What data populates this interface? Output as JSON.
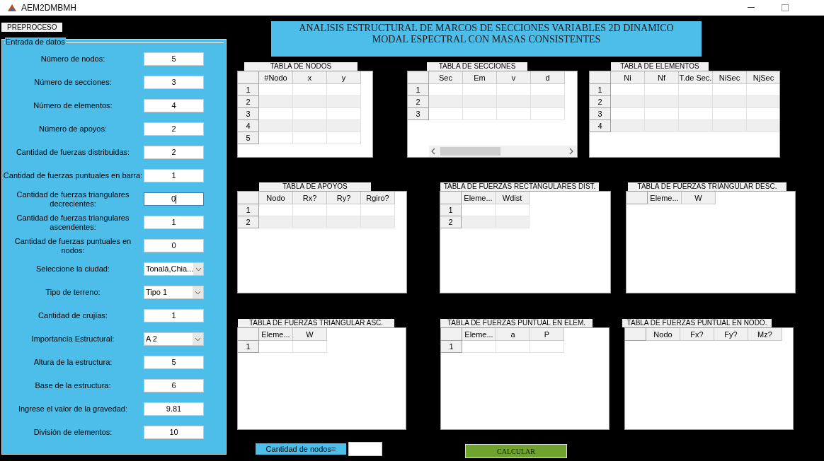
{
  "window": {
    "title": "AEM2DMBMH"
  },
  "menu_tab": "PREPROCESO",
  "header": {
    "line_1": "ANALISIS ESTRUCTURAL DE MARCOS DE SECCIONES VARIABLES 2D DINAMICO",
    "line_2": "MODAL ESPECTRAL CON MASAS CONSISTENTES"
  },
  "input_panel": {
    "title": "Entrada de datos",
    "fields": [
      {
        "label": "Número de nodos:",
        "kind": "text",
        "value": "5",
        "focused": false
      },
      {
        "label": "Número de secciones:",
        "kind": "text",
        "value": "3",
        "focused": false
      },
      {
        "label": "Número de elementos:",
        "kind": "text",
        "value": "4",
        "focused": false
      },
      {
        "label": "Número de apoyos:",
        "kind": "text",
        "value": "2",
        "focused": false
      },
      {
        "label": "Cantidad de fuerzas distribuidas:",
        "kind": "text",
        "value": "2",
        "focused": false
      },
      {
        "label": "Cantidad de fuerzas puntuales en barra:",
        "kind": "text",
        "value": "1",
        "focused": false
      },
      {
        "label": "Cantidad de fuerzas triangulares decrecientes:",
        "kind": "text",
        "value": "0",
        "focused": true
      },
      {
        "label": "Cantidad de fuerzas triangulares ascendentes:",
        "kind": "text",
        "value": "1",
        "focused": false
      },
      {
        "label": "Cantidad de fuerzas puntuales en nodos:",
        "kind": "text",
        "value": "0",
        "focused": false
      },
      {
        "label": "Seleccione la ciudad:",
        "kind": "dropdown",
        "value": "Tonalá,Chia...",
        "focused": false
      },
      {
        "label": "Tipo de terreno:",
        "kind": "dropdown",
        "value": "Tipo 1",
        "focused": false
      },
      {
        "label": "Cantidad de crujías:",
        "kind": "text",
        "value": "1",
        "focused": false
      },
      {
        "label": "Importancía Estructural:",
        "kind": "dropdown",
        "value": "A 2",
        "focused": false
      },
      {
        "label": "Altura de la estructura:",
        "kind": "text",
        "value": "5",
        "focused": false
      },
      {
        "label": "Base de la estructura:",
        "kind": "text",
        "value": "6",
        "focused": false
      },
      {
        "label": "Ingrese el valor de la gravedad:",
        "kind": "text",
        "value": "9.81",
        "focused": false
      },
      {
        "label": "División de elementos:",
        "kind": "text",
        "value": "10",
        "focused": false
      }
    ]
  },
  "tables": [
    {
      "title": "TABLA DE NODOS",
      "kind": "plain",
      "columns": [
        "#Nodo",
        "x",
        "y"
      ],
      "rows": [
        "1",
        "2",
        "3",
        "4",
        "5"
      ]
    },
    {
      "title": "TABLA DE SECCIONES",
      "kind": "scrolling",
      "columns": [
        "Sec",
        "Em",
        "v",
        "d"
      ],
      "rows": [
        "1",
        "2",
        "3"
      ]
    },
    {
      "title": "TABLA DE ELEMENTOS",
      "kind": "plain",
      "columns": [
        "Ni",
        "Nf",
        "T.de Sec.",
        "NiSec",
        "NjSec"
      ],
      "rows": [
        "1",
        "2",
        "3",
        "4"
      ]
    },
    {
      "title": "TABLA DE APOYOS",
      "kind": "plain",
      "columns": [
        "Nodo",
        "Rx?",
        "Ry?",
        "Rgiro?"
      ],
      "rows": [
        "1",
        "2"
      ]
    },
    {
      "title": "TABLA DE FUERZAS RECTANGULARES DIST.",
      "kind": "plain",
      "columns": [
        "Eleme...",
        "Wdist"
      ],
      "rows": [
        "1",
        "2"
      ]
    },
    {
      "title": "TABLA DE FUERZAS TRIANGULAR DESC.",
      "kind": "plain",
      "columns": [
        "Eleme...",
        "W"
      ]
    },
    {
      "title": "TABLA DE FUERZAS TRIANGULAR ASC.",
      "kind": "plain",
      "columns": [
        "Eleme...",
        "W"
      ],
      "rows": [
        "1"
      ]
    },
    {
      "title": "TABLA DE FUERZAS PUNTUAL EN ELEM.",
      "kind": "plain",
      "columns": [
        "Eleme...",
        "a",
        "P"
      ],
      "rows": [
        "1"
      ]
    },
    {
      "title": "TABLA DE FUERZAS PUNTUAL EN NODO.",
      "kind": "plain",
      "columns": [
        "Nodo",
        "Fx?",
        "Fy?",
        "Mz?"
      ]
    }
  ],
  "node_count": {
    "label": "Cantidad de nodos="
  },
  "calculate_button": "CALCULAR"
}
